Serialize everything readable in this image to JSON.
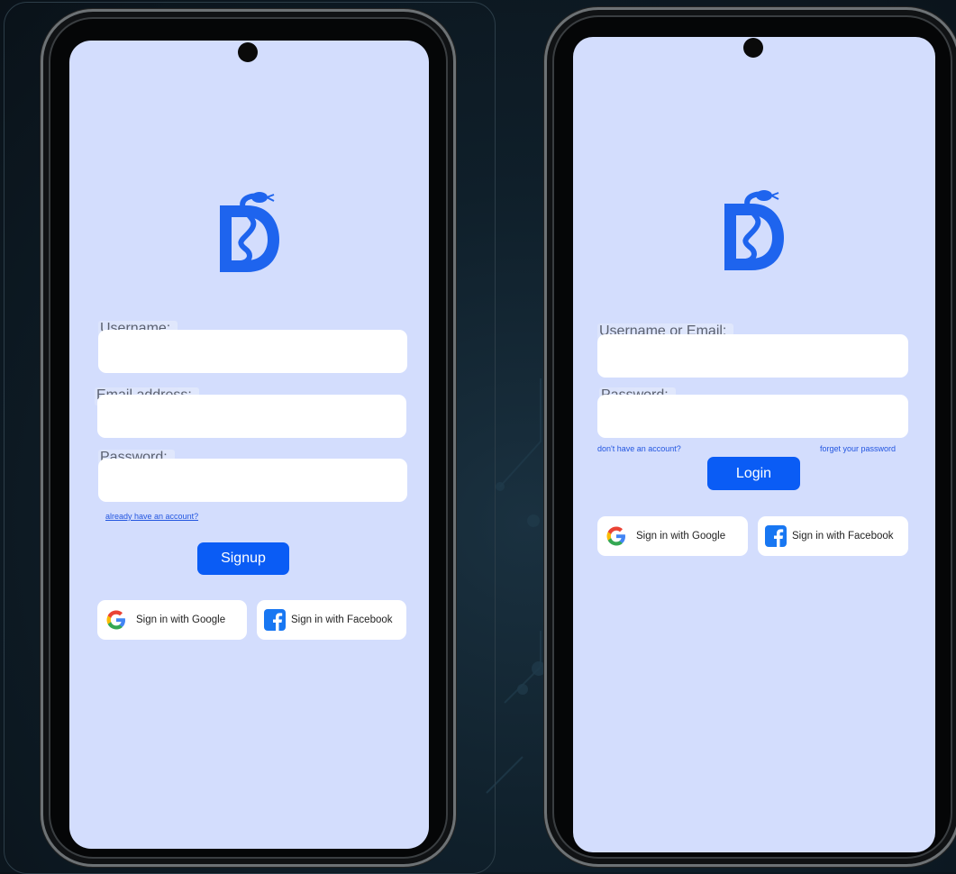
{
  "colors": {
    "screen_bg": "#d3ddfd",
    "primary": "#0a5cf5",
    "logo": "#1e64ee",
    "link": "#2356e0",
    "facebook": "#1877f2"
  },
  "signup_screen": {
    "logo_icon": "snake-ds-logo-icon",
    "username_label": "Username:",
    "email_label": "Email address:",
    "password_label": "Password:",
    "already_account_link": "already have an account?",
    "signup_button": "Signup",
    "google_button": "Sign in with Google",
    "facebook_button": "Sign in with Facebook"
  },
  "login_screen": {
    "logo_icon": "snake-ds-logo-icon",
    "username_label": "Username or Email:",
    "password_label": "Password:",
    "no_account_link": "don't have an account?",
    "forgot_password_link": "forget your password",
    "login_button": "Login",
    "google_button": "Sign in with Google",
    "facebook_button": "Sign in with Facebook"
  }
}
